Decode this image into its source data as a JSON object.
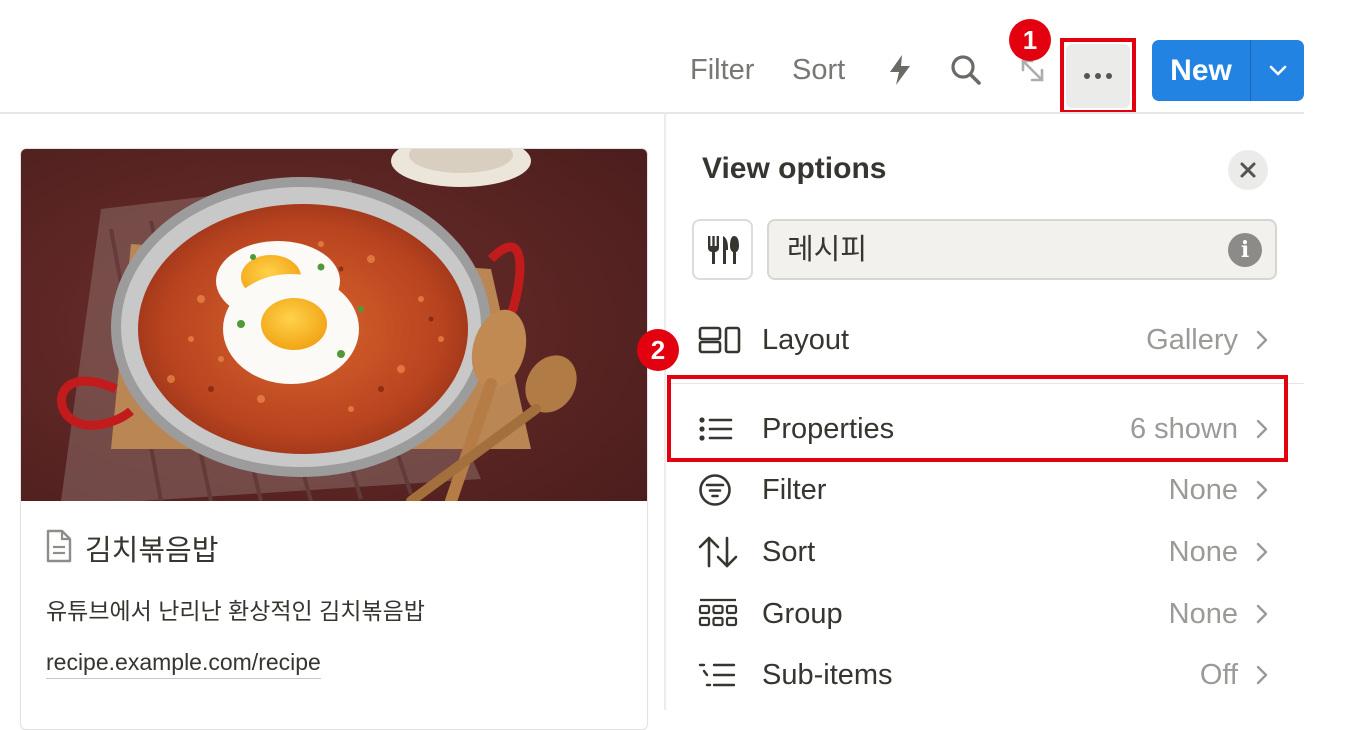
{
  "toolbar": {
    "filter_label": "Filter",
    "sort_label": "Sort",
    "new_label": "New",
    "icons": [
      "lightning-icon",
      "search-icon",
      "expand-icon",
      "more-icon",
      "chevron-down-icon"
    ],
    "accent_color": "#2383e2"
  },
  "annotations": {
    "badge1": "1",
    "badge2": "2",
    "highlight_color": "#e3000f"
  },
  "card": {
    "title": "김치볶음밥",
    "description": "유튜브에서 난리난 환상적인 김치볶음밥",
    "link": "recipe.example.com/recipe",
    "image_alt": "kimchi fried rice with eggs"
  },
  "panel": {
    "title": "View options",
    "name_value": "레시피",
    "options": [
      {
        "label": "Layout",
        "value": "Gallery"
      },
      {
        "label": "Properties",
        "value": "6 shown"
      },
      {
        "label": "Filter",
        "value": "None"
      },
      {
        "label": "Sort",
        "value": "None"
      },
      {
        "label": "Group",
        "value": "None"
      },
      {
        "label": "Sub-items",
        "value": "Off"
      }
    ]
  }
}
